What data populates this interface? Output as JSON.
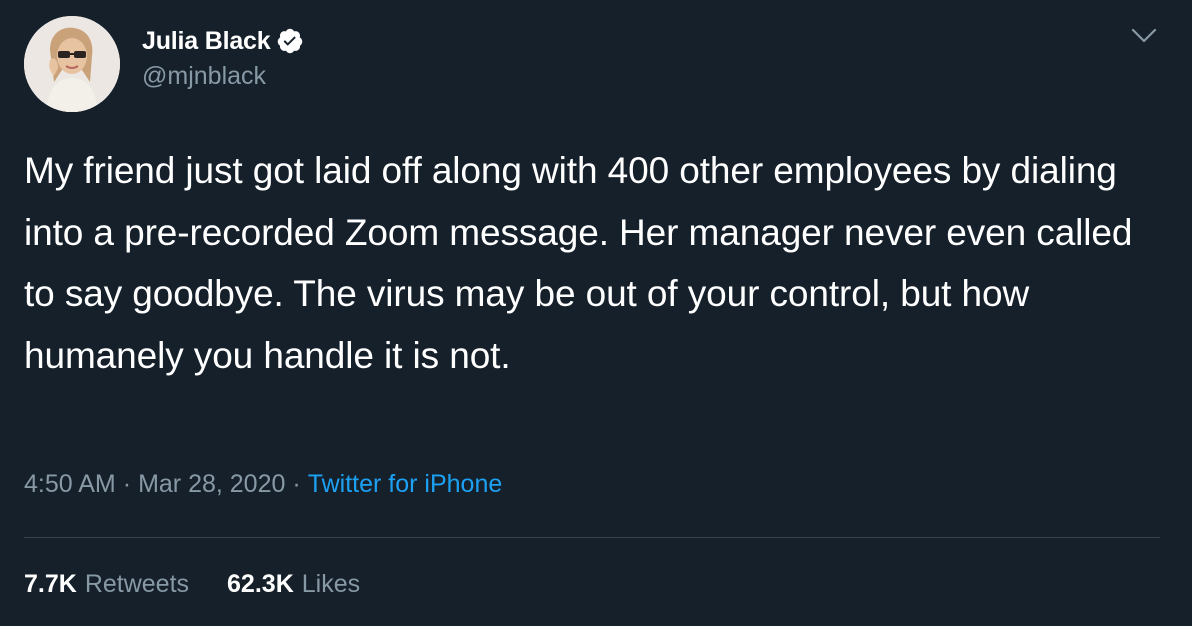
{
  "author": {
    "display_name": "Julia Black",
    "handle": "@mjnblack",
    "verified": true,
    "avatar_icon": "profile-photo"
  },
  "tweet": {
    "text": "My friend just got laid off along with 400 other employees by dialing into a pre-recorded Zoom message. Her manager never even called to say goodbye. The virus may be out of your control, but how humanely you handle it is not.",
    "time": "4:50 AM",
    "date": "Mar 28, 2020",
    "separator": "·",
    "source": "Twitter for iPhone"
  },
  "stats": {
    "retweets_count": "7.7K",
    "retweets_label": "Retweets",
    "likes_count": "62.3K",
    "likes_label": "Likes"
  },
  "icons": {
    "menu": "chevron-down-icon",
    "verified": "verified-badge-icon"
  },
  "colors": {
    "background": "#15202b",
    "text_primary": "#ffffff",
    "text_secondary": "#8899a6",
    "link": "#1da1f2",
    "divider": "#38444d"
  }
}
